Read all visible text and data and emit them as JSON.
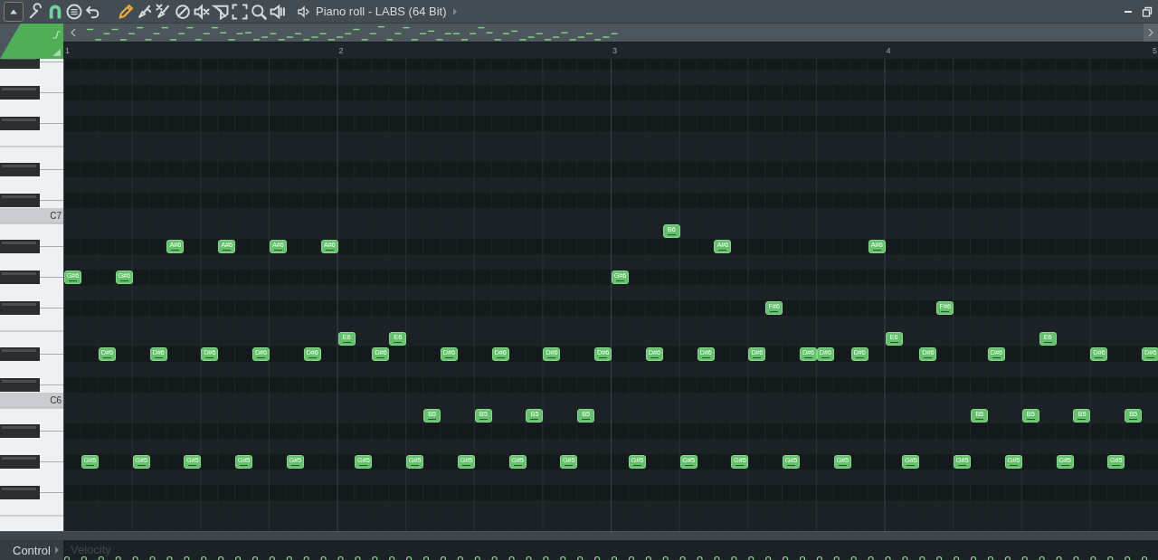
{
  "toolbar": {
    "tools": [
      {
        "kind": "menu",
        "selected": false
      },
      {
        "kind": "wrench",
        "selected": false
      },
      {
        "kind": "magnet",
        "selected": true
      },
      {
        "kind": "list",
        "selected": false
      },
      {
        "kind": "undo",
        "selected": false
      },
      {
        "kind": "pencil",
        "selected": true
      },
      {
        "kind": "brush",
        "selected": false
      },
      {
        "kind": "delete-brush",
        "selected": false
      },
      {
        "kind": "disable",
        "selected": false
      },
      {
        "kind": "mute",
        "selected": false
      },
      {
        "kind": "slice",
        "selected": false
      },
      {
        "kind": "select",
        "selected": false
      },
      {
        "kind": "zoom",
        "selected": false
      },
      {
        "kind": "playback",
        "selected": false
      }
    ],
    "title": "Piano roll - LABS (64 Bit)"
  },
  "ruler": {
    "bars": [
      "1",
      "2",
      "3",
      "4",
      "5"
    ]
  },
  "keyboard": {
    "labels": [
      "C7",
      "C6"
    ]
  },
  "notes": [
    "G#6",
    "G#6",
    "A#6",
    "A#6",
    "A#6",
    "A#6",
    "E6",
    "E6",
    "D#6",
    "D#6",
    "D#6",
    "D#6",
    "D#6",
    "D#6",
    "D#6",
    "D#6",
    "D#6",
    "B5",
    "B5",
    "B5",
    "B5",
    "G#5",
    "G#5",
    "G#5",
    "G#5",
    "G#5",
    "G#5",
    "G#5",
    "G#5",
    "G#5",
    "G#5",
    "B6",
    "A#6",
    "A#6",
    "G#6",
    "F#6",
    "F#6",
    "E6",
    "E6",
    "D#6",
    "D#6",
    "D#6",
    "D#6",
    "D#6",
    "D#6",
    "D#6",
    "D#6",
    "D#6",
    "D#6",
    "D#6",
    "B5",
    "B5",
    "B5",
    "B5",
    "G#5",
    "G#5",
    "G#5",
    "G#5",
    "G#5",
    "G#5",
    "G#5",
    "G#5",
    "G#5",
    "G#5"
  ],
  "control": {
    "label": "Control",
    "parameter": "Velocity"
  }
}
